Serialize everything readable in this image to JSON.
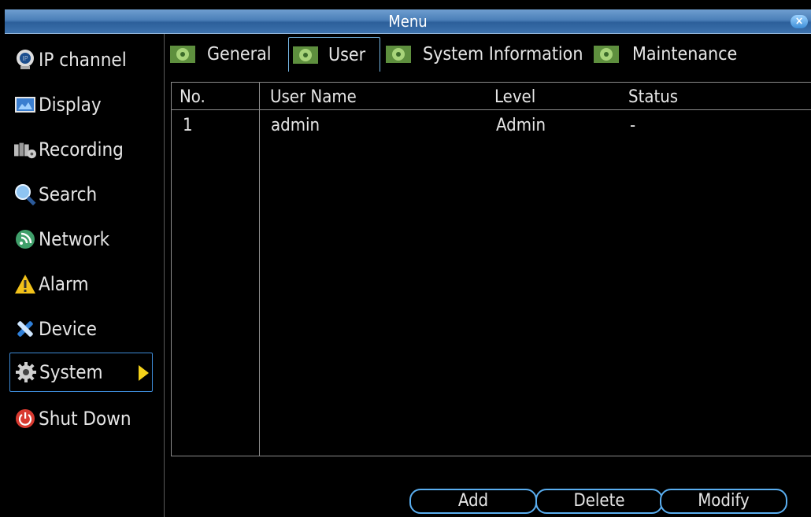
{
  "window": {
    "title": "Menu",
    "close_label": "×"
  },
  "sidebar": {
    "items": [
      {
        "label": "IP channel",
        "icon": "ip-channel-icon"
      },
      {
        "label": "Display",
        "icon": "display-icon"
      },
      {
        "label": "Recording",
        "icon": "recording-icon"
      },
      {
        "label": "Search",
        "icon": "search-icon"
      },
      {
        "label": "Network",
        "icon": "network-icon"
      },
      {
        "label": "Alarm",
        "icon": "alarm-icon"
      },
      {
        "label": "Device",
        "icon": "device-icon"
      },
      {
        "label": "System",
        "icon": "gear-icon",
        "active": true
      },
      {
        "label": "Shut Down",
        "icon": "power-icon"
      }
    ]
  },
  "tabs": [
    {
      "label": "General"
    },
    {
      "label": "User",
      "active": true
    },
    {
      "label": "System Information"
    },
    {
      "label": "Maintenance"
    }
  ],
  "table": {
    "headers": [
      "No.",
      "User Name",
      "Level",
      "Status"
    ],
    "rows": [
      [
        "1",
        "admin",
        "Admin",
        "-"
      ]
    ]
  },
  "buttons": {
    "add": "Add",
    "delete": "Delete",
    "modify": "Modify"
  },
  "colors": {
    "accent": "#3d8ad6",
    "title_bar": "#4b7fb8",
    "arrow": "#f4d21a"
  }
}
